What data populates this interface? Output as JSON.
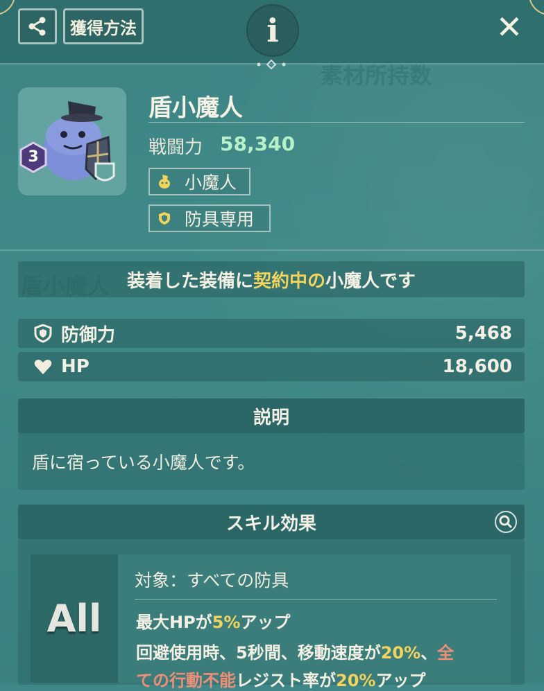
{
  "topbar": {
    "share_label": "share",
    "howto_label": "獲得方法",
    "info_label": "i",
    "close_label": "✕"
  },
  "item": {
    "name": "盾小魔人",
    "level": "3",
    "power_label": "戦闘力",
    "power_value": "58,340",
    "tags": [
      {
        "icon": "imp-icon",
        "label": "小魔人"
      },
      {
        "icon": "shield-icon",
        "label": "防具専用"
      }
    ]
  },
  "notice": {
    "part1": "装着した装備に",
    "highlight": "契約中の",
    "part2": "小魔人です"
  },
  "stats": [
    {
      "icon": "shield-icon",
      "label": "防御力",
      "value": "5,468"
    },
    {
      "icon": "heart-icon",
      "label": "HP",
      "value": "18,600"
    }
  ],
  "description": {
    "title": "説明",
    "text": "盾に宿っている小魔人です。"
  },
  "skill": {
    "title": "スキル効果",
    "badge": "All",
    "target": "対象：すべての防具",
    "line1": {
      "a": "最大HPが",
      "b": "5%",
      "c": "アップ"
    },
    "line2": {
      "a": "回避使用時、5秒間、移動速度が",
      "b": "20%",
      "c": "、",
      "d": "全"
    },
    "line3": {
      "a": "ての行動不能",
      "b": "レジスト率が",
      "c": "20%",
      "d": "アップ"
    }
  },
  "colors": {
    "background": "#3f8887",
    "power": "#b6f0c8",
    "highlight": "#f2d35c",
    "warning": "#f08e78"
  }
}
